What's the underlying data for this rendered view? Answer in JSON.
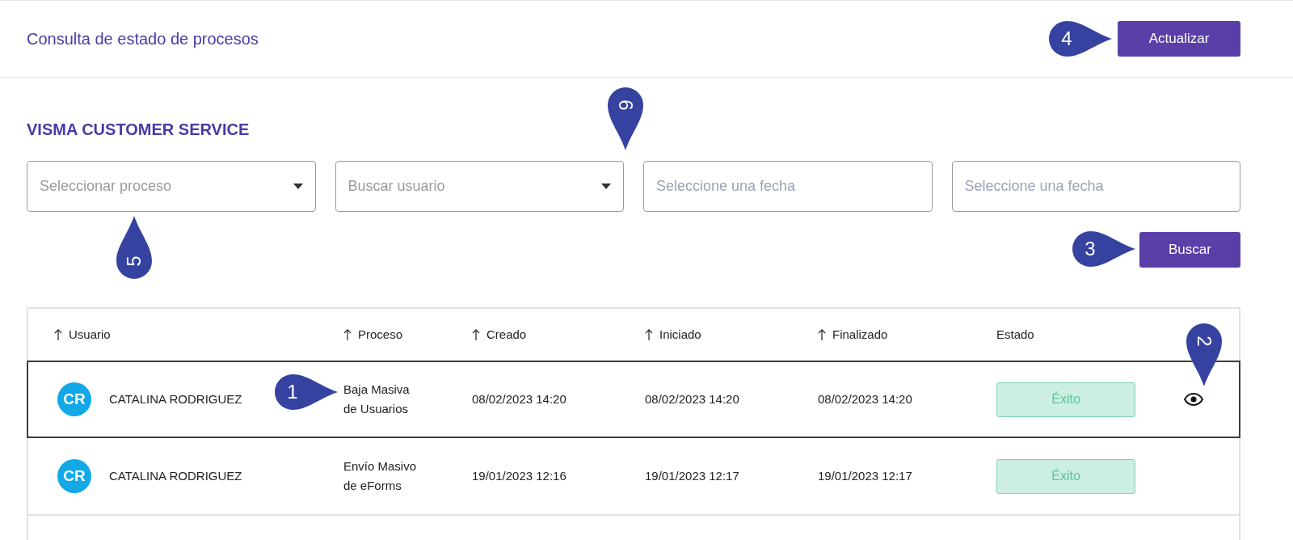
{
  "header": {
    "title": "Consulta de estado de procesos",
    "refresh_button": "Actualizar"
  },
  "section_title": "VISMA CUSTOMER SERVICE",
  "filters": [
    {
      "kind": "select",
      "placeholder": "Seleccionar proceso"
    },
    {
      "kind": "select",
      "placeholder": "Buscar usuario"
    },
    {
      "kind": "date",
      "placeholder": "Seleccione una fecha"
    },
    {
      "kind": "date",
      "placeholder": "Seleccione una fecha"
    }
  ],
  "search_button": "Buscar",
  "table": {
    "columns": [
      {
        "label": "Usuario",
        "sortable": true
      },
      {
        "label": "Proceso",
        "sortable": true
      },
      {
        "label": "Creado",
        "sortable": true
      },
      {
        "label": "Iniciado",
        "sortable": true
      },
      {
        "label": "Finalizado",
        "sortable": true
      },
      {
        "label": "Estado",
        "sortable": false
      }
    ],
    "rows": [
      {
        "initials": "CR",
        "user": "CATALINA RODRIGUEZ",
        "process": "Baja Masiva de Usuarios",
        "created": "08/02/2023 14:20",
        "started": "08/02/2023 14:20",
        "finished": "08/02/2023 14:20",
        "status": {
          "label": "Éxito",
          "kind": "success"
        },
        "selected": true
      },
      {
        "initials": "CR",
        "user": "CATALINA RODRIGUEZ",
        "process": "Envío Masivo de eForms",
        "created": "19/01/2023 12:16",
        "started": "19/01/2023 12:17",
        "finished": "19/01/2023 12:17",
        "status": {
          "label": "Éxito",
          "kind": "success"
        },
        "selected": false
      }
    ]
  },
  "callouts": [
    {
      "number": "1",
      "kind": "right"
    },
    {
      "number": "2",
      "kind": "down"
    },
    {
      "number": "3",
      "kind": "right"
    },
    {
      "number": "4",
      "kind": "right"
    },
    {
      "number": "5",
      "kind": "up"
    },
    {
      "number": "6",
      "kind": "down"
    }
  ]
}
